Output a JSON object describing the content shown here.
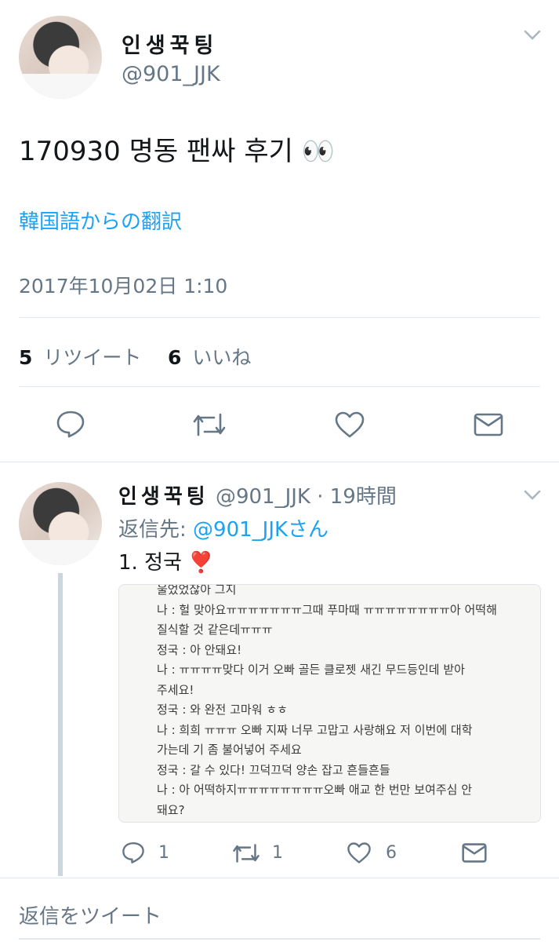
{
  "main_tweet": {
    "display_name": "인생꾹팅",
    "handle": "@901_JJK",
    "text": "170930 명동 팬싸 후기 👀",
    "translate_label": "韓国語からの翻訳",
    "timestamp": "2017年10月02日 1:10",
    "retweet_count": "5",
    "retweet_label": "リツイート",
    "like_count": "6",
    "like_label": "いいね"
  },
  "reply_tweet": {
    "display_name": "인생꾹팅",
    "handle": "@901_JJK",
    "age": "· 19時間",
    "reply_to_prefix": "返信先:",
    "reply_to_handle": "@901_JJKさん",
    "text": "1. 정국 ❣️",
    "image_lines": [
      "울었었잖아 그지",
      "나 : 헐 맞아요ㅠㅠㅠㅠㅠㅠㅠ그때 푸마때 ㅠㅠㅠㅠㅠㅠㅠㅠ아 어떡해",
      "질식할 것 같은데ㅠㅠㅠ",
      "정국 : 아 안돼요!",
      "나 : ㅠㅠㅠㅠ맞다 이거 오빠 골든 클로젯 새긴 무드등인데 받아",
      "주세요!",
      "정국 : 와 완전 고마워 ㅎㅎ",
      "나 : 희희 ㅠㅠㅠ 오빠 지짜 너무 고맙고 사랑해요 저 이번에 대학",
      "가는데 기 좀 불어넣어 주세요",
      "정국 : 갈 수 있다! 끄덕끄덕 양손 잡고 흔들흔들",
      "나 : 아 어떡하지ㅠㅠㅠㅠㅠㅠㅠㅠ오빠 애교 한 번만 보여주심 안",
      "돼요?"
    ],
    "reply_count": "1",
    "retweet_count": "1",
    "like_count": "6"
  },
  "reply_box": {
    "placeholder": "返信をツイート"
  },
  "icons": {
    "reply": "reply-icon",
    "retweet": "retweet-icon",
    "like": "heart-icon",
    "dm": "mail-icon",
    "more": "chevron-down-icon"
  },
  "colors": {
    "link": "#1da1f2",
    "secondary_text": "#657786",
    "icon": "#657786",
    "thread_line": "#ccd6dd",
    "divider": "#e1e8ed"
  }
}
